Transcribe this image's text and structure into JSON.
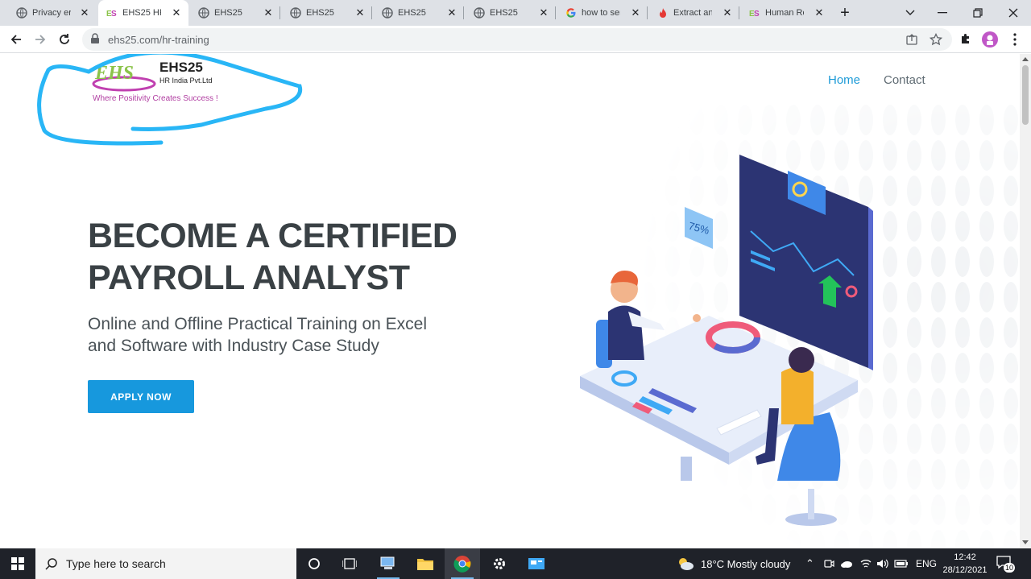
{
  "browser": {
    "tabs": [
      {
        "title": "Privacy err",
        "icon": "globe-icon"
      },
      {
        "title": "EHS25 HR",
        "icon": "ehs-favicon",
        "active": true
      },
      {
        "title": "EHS25",
        "icon": "globe-icon"
      },
      {
        "title": "EHS25",
        "icon": "globe-icon"
      },
      {
        "title": "EHS25",
        "icon": "globe-icon"
      },
      {
        "title": "EHS25",
        "icon": "globe-icon"
      },
      {
        "title": "how to ser",
        "icon": "google-icon"
      },
      {
        "title": "Extract an",
        "icon": "fire-icon"
      },
      {
        "title": "Human Re",
        "icon": "ehs-favicon"
      }
    ],
    "url": "ehs25.com/hr-training"
  },
  "site": {
    "logo": {
      "mark": "EHS",
      "brand": "EHS25",
      "sub": "HR India Pvt.Ltd",
      "tagline": "Where Positivity Creates Success !"
    },
    "nav": [
      {
        "label": "Home",
        "active": true
      },
      {
        "label": "Contact"
      }
    ],
    "hero": {
      "title_line1": "BECOME A CERTIFIED",
      "title_line2": "PAYROLL ANALYST",
      "subtitle_line1": "Online and Offline Practical Training on Excel",
      "subtitle_line2": "and Software with Industry Case Study",
      "cta": "APPLY NOW",
      "illustration_badge": "75%"
    }
  },
  "taskbar": {
    "search_placeholder": "Type here to search",
    "weather": "18°C  Mostly cloudy",
    "language": "ENG",
    "time": "12:42",
    "date": "28/12/2021",
    "notifications": "10"
  },
  "colors": {
    "accent": "#1798dd",
    "annotation": "#29b6f6",
    "heading": "#3a4145"
  }
}
